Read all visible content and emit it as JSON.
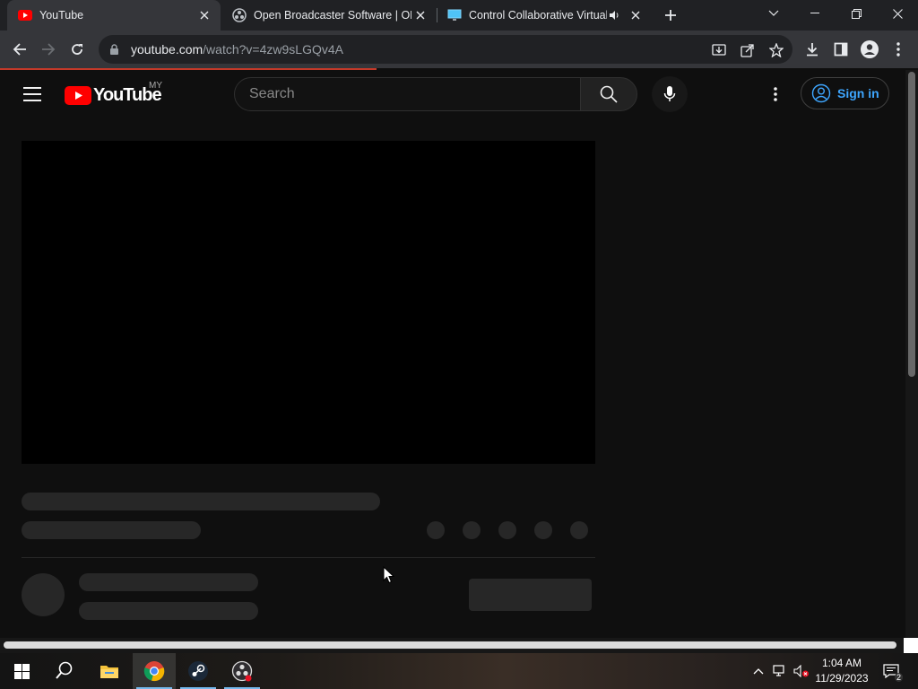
{
  "browser": {
    "tabs": [
      {
        "title": "YouTube",
        "favicon": "youtube-icon",
        "active": true
      },
      {
        "title": "Open Broadcaster Software | OBS",
        "favicon": "obs-icon",
        "active": false
      },
      {
        "title": "Control Collaborative Virtual",
        "favicon": "monitor-icon",
        "active": false,
        "audio": true
      }
    ],
    "address_bar": {
      "host": "youtube.com",
      "path": "/watch?v=4zw9sLGQv4A"
    }
  },
  "youtube": {
    "logo_text": "YouTube",
    "country_code": "MY",
    "search_placeholder": "Search",
    "sign_in_label": "Sign in",
    "accent_color": "#3ea6ff",
    "brand_color": "#ff0000"
  },
  "taskbar": {
    "apps": [
      "start-icon",
      "search-icon",
      "file-explorer-icon",
      "chrome-icon",
      "steam-icon",
      "obs-icon"
    ],
    "clock_time": "1:04 AM",
    "clock_date": "11/29/2023",
    "notification_count": "2"
  }
}
